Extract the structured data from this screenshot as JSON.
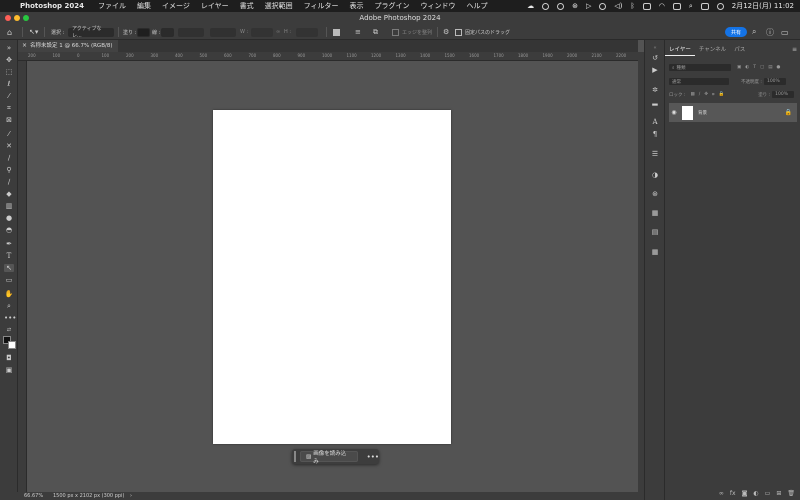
{
  "menubar": {
    "apple_icon": "apple-icon",
    "app_name": "Photoshop 2024",
    "menus": [
      "ファイル",
      "編集",
      "イメージ",
      "レイヤー",
      "書式",
      "選択範囲",
      "フィルター",
      "表示",
      "プラグイン",
      "ウィンドウ",
      "ヘルプ"
    ],
    "clock": "2月12日(月)  11:02"
  },
  "window": {
    "title": "Adobe Photoshop 2024"
  },
  "options_bar": {
    "select_label": "選択 :",
    "select_value": "アクティブなレ...",
    "fill_label": "塗り :",
    "stroke_label": "線 :",
    "width_label": "W :",
    "height_label": "H :",
    "align_edges_label": "エッジを整列",
    "fixed_path_label": "固定パスのドラッグ",
    "share_button": "共有"
  },
  "document": {
    "tab_title": "名称未設定 1 @ 66.7% (RGB/8)",
    "close_glyph": "×"
  },
  "ruler_ticks": [
    "200",
    "100",
    "0",
    "100",
    "200",
    "300",
    "400",
    "500",
    "600",
    "700",
    "800",
    "900",
    "1000",
    "1100",
    "1200",
    "1300",
    "1400",
    "1500",
    "1600",
    "1700",
    "1800",
    "1900",
    "2000",
    "2100",
    "2200",
    "2300",
    "2400"
  ],
  "contextual_bar": {
    "import_image": "画像を読み込み",
    "more": "•••"
  },
  "status_bar": {
    "zoom": "66.67%",
    "doc_info": "1500 px x 2102 px (300 ppi)",
    "arrow": "›"
  },
  "layers_panel": {
    "tabs": [
      "レイヤー",
      "チャンネル",
      "パス"
    ],
    "search_placeholder": "種類",
    "blend_mode": "通常",
    "opacity_label": "不透明度 :",
    "opacity_value": "100%",
    "lock_label": "ロック :",
    "fill_label": "塗り :",
    "fill_value": "100%",
    "layers": [
      {
        "name": "背景",
        "visible": true,
        "locked": true
      }
    ]
  },
  "colors": {
    "canvas_bg": "#535353",
    "panel_bg": "#3c3c3c",
    "accent": "#1473e6",
    "artboard": "#ffffff"
  }
}
